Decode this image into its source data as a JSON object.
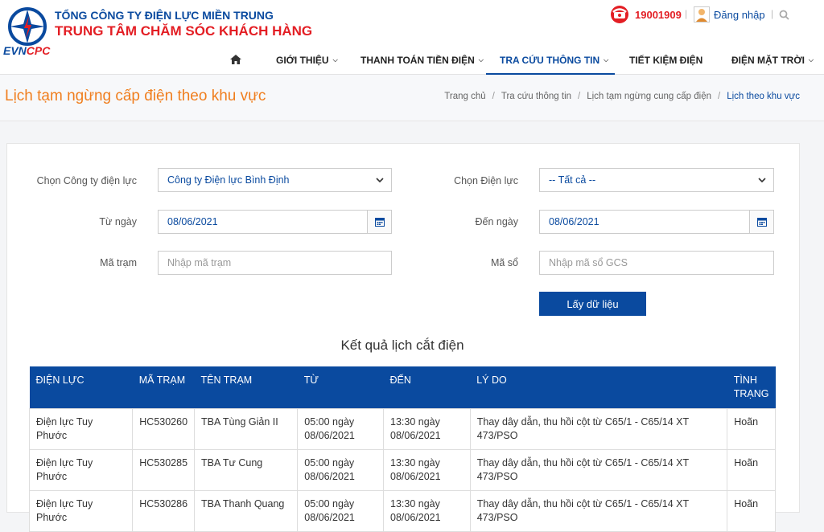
{
  "header": {
    "logo_evn": "EVN",
    "logo_cpc": "CPC",
    "org_line1": "TỔNG CÔNG TY ĐIỆN LỰC MIỀN TRUNG",
    "org_line2": "TRUNG TÂM CHĂM SÓC KHÁCH HÀNG",
    "hotline": "19001909",
    "separator": "|",
    "login": "Đăng nhập"
  },
  "nav": {
    "items": [
      {
        "label": "GIỚI THIỆU"
      },
      {
        "label": "THANH TOÁN TIỀN ĐIỆN"
      },
      {
        "label": "TRA CỨU THÔNG TIN"
      },
      {
        "label": "TIẾT KIỆM ĐIỆN"
      },
      {
        "label": "ĐIỆN MẶT TRỜI"
      }
    ]
  },
  "page": {
    "title": "Lịch tạm ngừng cấp điện theo khu vực",
    "breadcrumb": [
      "Trang chủ",
      "Tra cứu thông tin",
      "Lịch tạm ngừng cung cấp điện",
      "Lịch theo khu vực"
    ],
    "crumb_sep": "/"
  },
  "form": {
    "company_label": "Chọn Công ty điện lực",
    "company_value": "Công ty Điện lực Bình Định",
    "branch_label": "Chọn Điện lực",
    "branch_value": "-- Tất cả --",
    "from_label": "Từ ngày",
    "from_value": "08/06/2021",
    "to_label": "Đến ngày",
    "to_value": "08/06/2021",
    "station_label": "Mã trạm",
    "station_placeholder": "Nhập mã trạm",
    "gcs_label": "Mã sổ",
    "gcs_placeholder": "Nhập mã sổ GCS",
    "submit": "Lấy dữ liệu"
  },
  "results": {
    "title": "Kết quả lịch cắt điện",
    "headers": [
      "ĐIỆN LỰC",
      "MÃ TRẠM",
      "TÊN TRẠM",
      "TỪ",
      "ĐẾN",
      "LÝ DO",
      "TÌNH TRẠNG"
    ],
    "rows": [
      [
        "Điện lực Tuy Phước",
        "HC530260",
        "TBA Tùng Giản II",
        "05:00 ngày 08/06/2021",
        "13:30 ngày 08/06/2021",
        "Thay dây dẫn, thu hồi cột từ C65/1 - C65/14 XT 473/PSO",
        "Hoãn"
      ],
      [
        "Điện lực Tuy Phước",
        "HC530285",
        "TBA Tư Cung",
        "05:00 ngày 08/06/2021",
        "13:30 ngày 08/06/2021",
        "Thay dây dẫn, thu hồi cột từ C65/1 - C65/14 XT 473/PSO",
        "Hoãn"
      ],
      [
        "Điện lực Tuy Phước",
        "HC530286",
        "TBA Thanh Quang",
        "05:00 ngày 08/06/2021",
        "13:30 ngày 08/06/2021",
        "Thay dây dẫn, thu hồi cột từ C65/1 - C65/14 XT 473/PSO",
        "Hoãn"
      ]
    ]
  }
}
